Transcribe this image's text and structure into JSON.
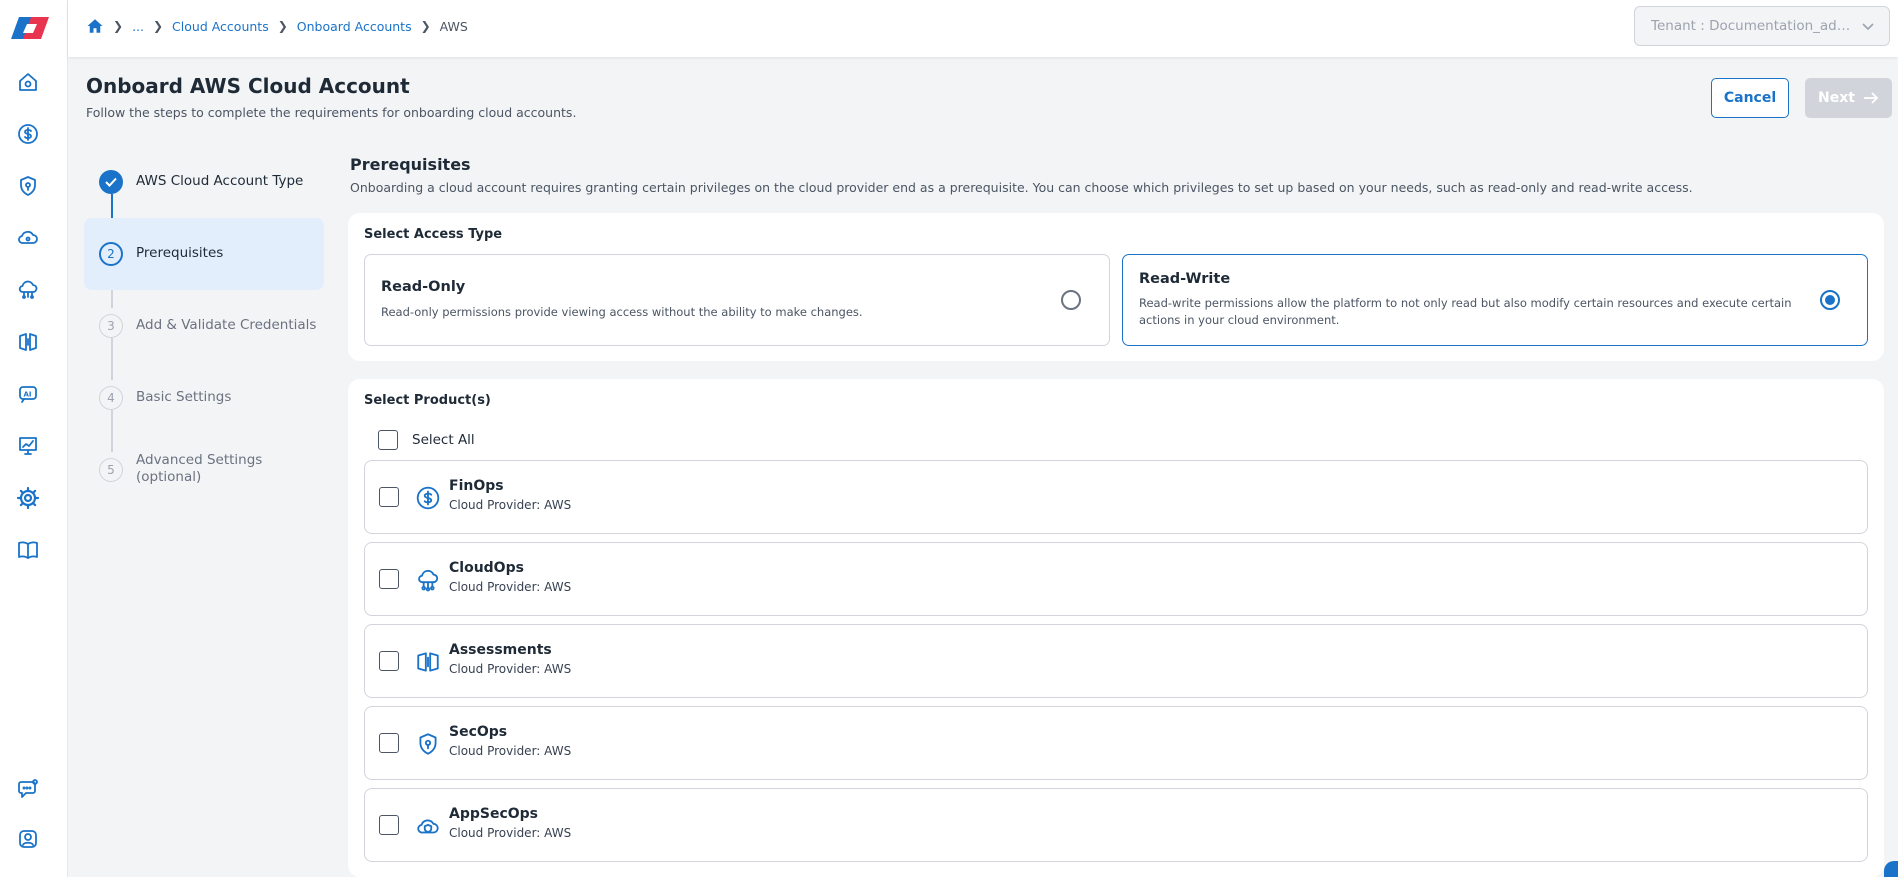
{
  "breadcrumb": {
    "ellipsis": "...",
    "items": [
      "Cloud Accounts",
      "Onboard Accounts"
    ],
    "current": "AWS"
  },
  "tenant": {
    "label": "Tenant : Documentation_admi..."
  },
  "header": {
    "title": "Onboard AWS Cloud Account",
    "subtitle": "Follow the steps to complete the requirements for onboarding cloud accounts.",
    "cancel_label": "Cancel",
    "next_label": "Next"
  },
  "steps": [
    {
      "number": "1",
      "label": "AWS Cloud Account Type",
      "status": "completed"
    },
    {
      "number": "2",
      "label": "Prerequisites",
      "status": "active"
    },
    {
      "number": "3",
      "label": "Add & Validate Credentials",
      "status": "pending"
    },
    {
      "number": "4",
      "label": "Basic Settings",
      "status": "pending"
    },
    {
      "number": "5",
      "label": "Advanced Settings (optional)",
      "status": "pending"
    }
  ],
  "prerequisites": {
    "title": "Prerequisites",
    "description": "Onboarding a cloud account requires granting certain privileges on the cloud provider end as a prerequisite. You can choose which privileges to set up based on your needs, such as read-only and read-write access."
  },
  "access": {
    "label": "Select Access Type",
    "options": [
      {
        "title": "Read-Only",
        "description": "Read-only permissions provide viewing access without the ability to make changes.",
        "selected": false
      },
      {
        "title": "Read-Write",
        "description": "Read-write permissions allow the platform to not only read but also modify certain resources and execute certain actions in your cloud environment.",
        "selected": true
      }
    ]
  },
  "products": {
    "label": "Select Product(s)",
    "select_all_label": "Select All",
    "items": [
      {
        "name": "FinOps",
        "provider": "Cloud Provider: AWS",
        "icon": "dollar-circle-icon",
        "checked": false
      },
      {
        "name": "CloudOps",
        "provider": "Cloud Provider: AWS",
        "icon": "cloud-network-icon",
        "checked": false
      },
      {
        "name": "Assessments",
        "provider": "Cloud Provider: AWS",
        "icon": "assessment-book-icon",
        "checked": false
      },
      {
        "name": "SecOps",
        "provider": "Cloud Provider: AWS",
        "icon": "shield-icon",
        "checked": false
      },
      {
        "name": "AppSecOps",
        "provider": "Cloud Provider: AWS",
        "icon": "cloud-shield-icon",
        "checked": false
      }
    ]
  },
  "colors": {
    "primary": "#1a73c8",
    "active_step_bg": "#e3eefc",
    "disabled_button": "#d1d5db",
    "page_bg": "#f3f4f6"
  }
}
